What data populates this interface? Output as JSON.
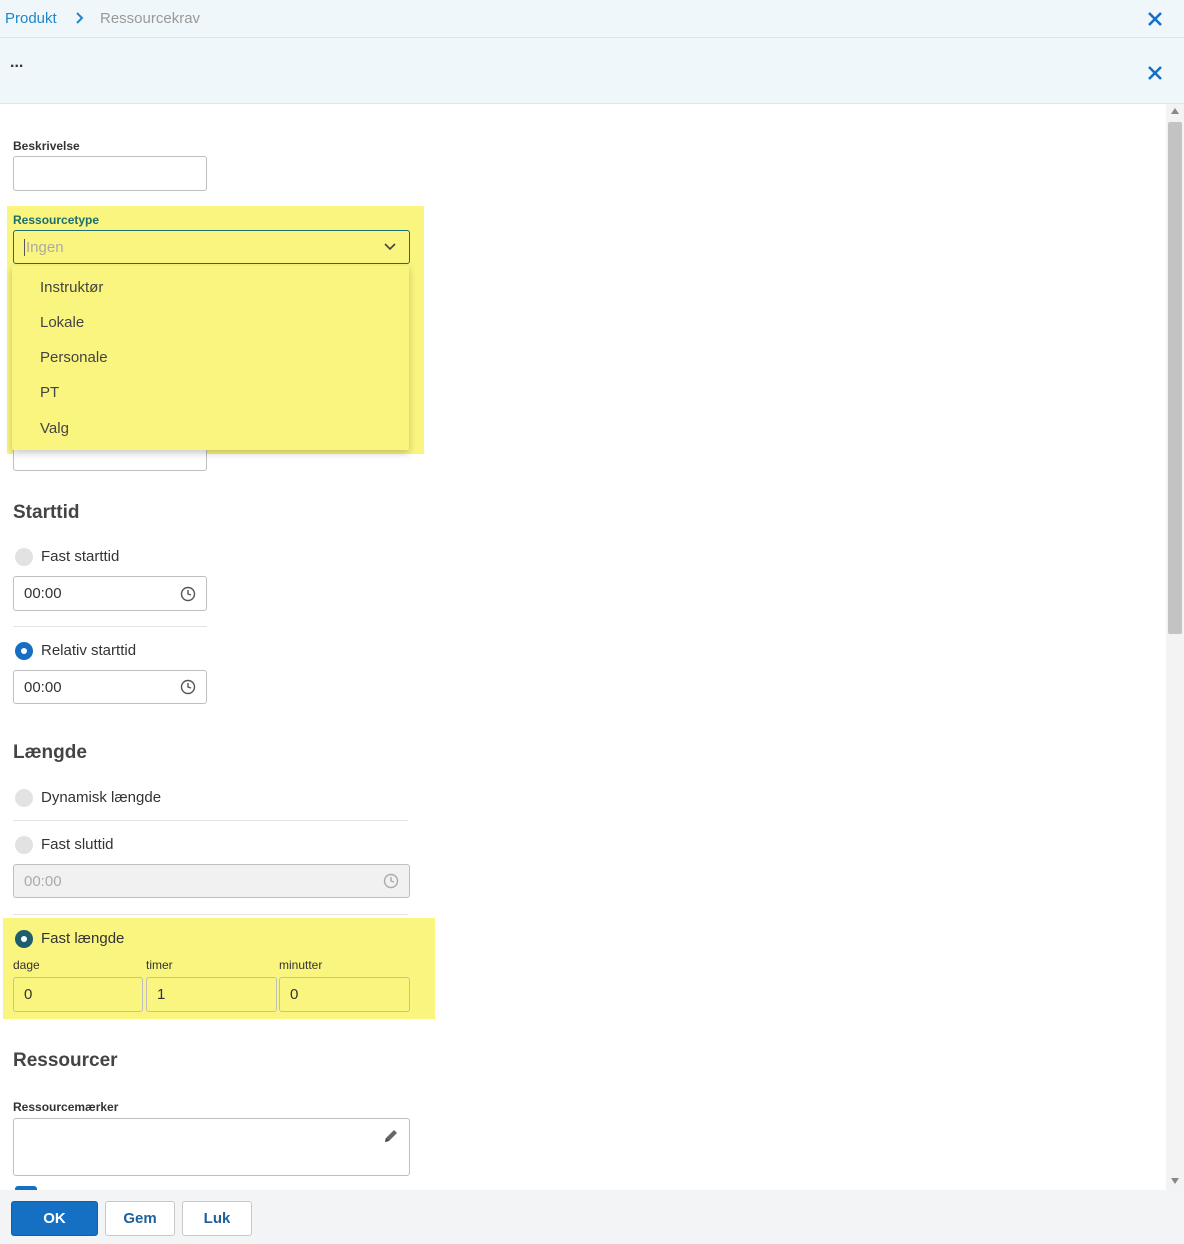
{
  "breadcrumb": {
    "parent": "Produkt",
    "current": "Ressourcekrav"
  },
  "subheader": {
    "more_label": "..."
  },
  "form": {
    "beskrivelse": {
      "label": "Beskrivelse",
      "value": ""
    },
    "ressourcetype": {
      "label": "Ressourcetype",
      "placeholder": "Ingen",
      "options": [
        "Instruktør",
        "Lokale",
        "Personale",
        "PT",
        "Valg"
      ]
    },
    "starttid": {
      "heading": "Starttid",
      "fast_label": "Fast starttid",
      "fast_value": "00:00",
      "relativ_label": "Relativ starttid",
      "relativ_value": "00:00",
      "selected": "relativ"
    },
    "laengde": {
      "heading": "Længde",
      "dynamisk_label": "Dynamisk længde",
      "fast_sluttid_label": "Fast sluttid",
      "fast_sluttid_value": "00:00",
      "fast_laengde_label": "Fast længde",
      "dage_label": "dage",
      "dage_value": "0",
      "timer_label": "timer",
      "timer_value": "1",
      "minutter_label": "minutter",
      "minutter_value": "0",
      "selected": "fast_laengde"
    },
    "ressourcer": {
      "heading": "Ressourcer",
      "maerker_label": "Ressourcemærker",
      "maerker_value": ""
    }
  },
  "footer": {
    "ok_label": "OK",
    "gem_label": "Gem",
    "luk_label": "Luk"
  },
  "colors": {
    "accent": "#1570c4",
    "highlight": "#faf57e",
    "link": "#1f87c7"
  }
}
